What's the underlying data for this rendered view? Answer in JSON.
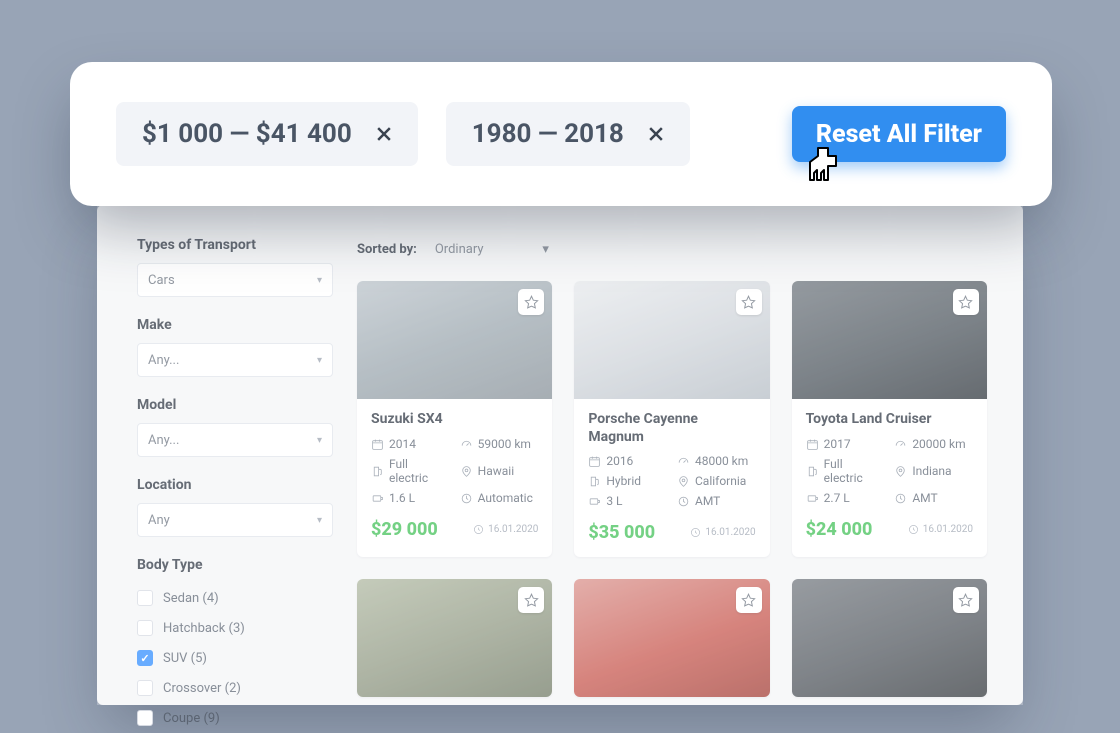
{
  "filters": {
    "price_chip": "$1 000 — $41 400",
    "year_chip": "1980 — 2018",
    "reset_label": "Reset All Filter"
  },
  "sidebar": {
    "transport_heading": "Types of Transport",
    "transport_value": "Cars",
    "make_heading": "Make",
    "make_value": "Any...",
    "model_heading": "Model",
    "model_value": "Any...",
    "location_heading": "Location",
    "location_value": "Any",
    "bodytype_heading": "Body Type",
    "bodytypes": [
      {
        "label": "Sedan (4)",
        "checked": false
      },
      {
        "label": "Hatchback (3)",
        "checked": false
      },
      {
        "label": "SUV (5)",
        "checked": true
      },
      {
        "label": "Crossover (2)",
        "checked": false
      },
      {
        "label": "Coupe (9)",
        "checked": false
      }
    ]
  },
  "sort": {
    "label": "Sorted by:",
    "value": "Ordinary"
  },
  "cards": [
    {
      "title": "Suzuki SX4",
      "year": "2014",
      "mileage": "59000 km",
      "fuel": "Full electric",
      "location": "Hawaii",
      "engine": "1.6 L",
      "trans": "Automatic",
      "price": "$29 000",
      "date": "16.01.2020",
      "shade": "silver"
    },
    {
      "title": "Porsche Cayenne Magnum",
      "year": "2016",
      "mileage": "48000 km",
      "fuel": "Hybrid",
      "location": "California",
      "engine": "3 L",
      "trans": "AMT",
      "price": "$35 000",
      "date": "16.01.2020",
      "shade": "white"
    },
    {
      "title": "Toyota Land Cruiser",
      "year": "2017",
      "mileage": "20000 km",
      "fuel": "Full electric",
      "location": "Indiana",
      "engine": "2.7 L",
      "trans": "AMT",
      "price": "$24 000",
      "date": "16.01.2020",
      "shade": "black"
    },
    {
      "shade": "green"
    },
    {
      "shade": "red"
    },
    {
      "shade": "dark"
    }
  ]
}
